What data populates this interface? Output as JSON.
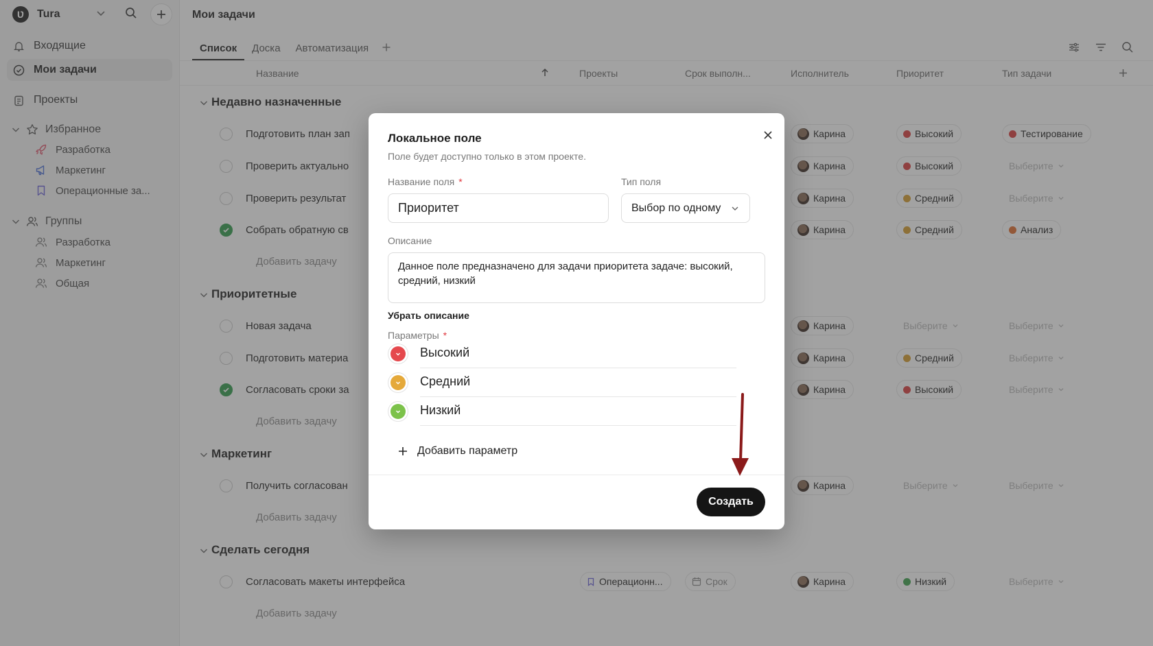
{
  "workspace": {
    "logo": "Ʋ",
    "name": "Tura"
  },
  "sidebar": {
    "inbox": "Входящие",
    "my_tasks": "Мои задачи",
    "projects": "Проекты",
    "favorites": {
      "label": "Избранное",
      "items": [
        "Разработка",
        "Маркетинг",
        "Операционные за..."
      ]
    },
    "groups": {
      "label": "Группы",
      "items": [
        "Разработка",
        "Маркетинг",
        "Общая"
      ]
    }
  },
  "main": {
    "title": "Мои задачи",
    "tabs": [
      "Список",
      "Доска",
      "Автоматизация"
    ],
    "columns": [
      "Название",
      "Проекты",
      "Срок выполн...",
      "Исполнитель",
      "Приоритет",
      "Тип задачи"
    ],
    "add_task": "Добавить задачу",
    "sections": [
      {
        "title": "Недавно назначенные",
        "tasks": [
          {
            "title": "Подготовить план зап",
            "done": false,
            "assignee": "Карина",
            "priority": "Высокий",
            "type": "Тестирование"
          },
          {
            "title": "Проверить актуально",
            "done": false,
            "assignee": "Карина",
            "priority": "Высокий",
            "type": "Выберите"
          },
          {
            "title": "Проверить результат",
            "done": false,
            "assignee": "Карина",
            "priority": "Средний",
            "type": "Выберите"
          },
          {
            "title": "Собрать обратную св",
            "done": true,
            "assignee": "Карина",
            "priority": "Средний",
            "type": "Анализ"
          }
        ]
      },
      {
        "title": "Приоритетные",
        "tasks": [
          {
            "title": "Новая задача",
            "done": false,
            "assignee": "Карина",
            "priority": "Выберите",
            "type": "Выберите"
          },
          {
            "title": "Подготовить материа",
            "done": false,
            "assignee": "Карина",
            "priority": "Средний",
            "type": "Выберите"
          },
          {
            "title": "Согласовать сроки за",
            "done": true,
            "assignee": "Карина",
            "priority": "Высокий",
            "type": "Выберите"
          }
        ]
      },
      {
        "title": "Маркетинг",
        "tasks": [
          {
            "title": "Получить согласован",
            "done": false,
            "assignee": "Карина",
            "priority": "Выберите",
            "type": "Выберите"
          }
        ]
      },
      {
        "title": "Сделать сегодня",
        "tasks": [
          {
            "title": "Согласовать макеты интерфейса",
            "done": false,
            "project": "Операционн...",
            "due": "Срок",
            "assignee": "Карина",
            "priority": "Низкий",
            "type": "Выберите"
          }
        ]
      }
    ]
  },
  "modal": {
    "title": "Локальное поле",
    "subtitle": "Поле будет доступно только в этом проекте.",
    "field_name_label": "Название поля",
    "field_name_value": "Приоритет",
    "field_type_label": "Тип поля",
    "field_type_value": "Выбор по одному",
    "description_label": "Описание",
    "description_value": "Данное поле предназначено для задачи приоритета задаче: высокий, средний, низкий",
    "remove_description": "Убрать описание",
    "params_label": "Параметры",
    "required_mark": "*",
    "params": [
      {
        "label": "Высокий",
        "color": "#e5484d"
      },
      {
        "label": "Средний",
        "color": "#e5a93a"
      },
      {
        "label": "Низкий",
        "color": "#7cc24a"
      }
    ],
    "add_param": "Добавить параметр",
    "create_button": "Создать"
  },
  "colors": {
    "high": "#d93a3a",
    "medium": "#d49a2a",
    "low": "#3aa04a",
    "testing": "#d93a3a",
    "analysis": "#e06a2a",
    "arrow": "#8b1a1a"
  }
}
